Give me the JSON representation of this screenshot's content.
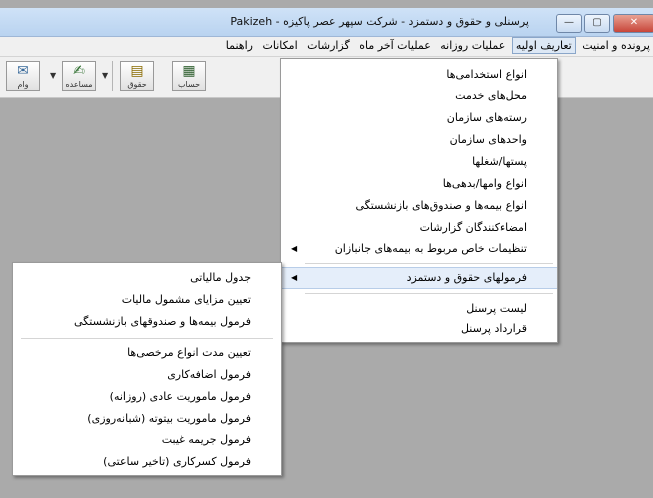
{
  "window": {
    "title": "پرسنلی و حقوق و دستمزد - شرکت سپهر عصر پاکیزه - Pakizeh",
    "buttons": {
      "close": "✕",
      "maximize": "▢",
      "minimize": "—"
    }
  },
  "menubar": {
    "items": [
      "پرونده و امنیت",
      "تعاریف اولیه",
      "عملیات روزانه",
      "عملیات آخر ماه",
      "گزارشات",
      "امکانات",
      "راهنما"
    ]
  },
  "toolbar": {
    "icons": [
      {
        "name": "calculator-icon",
        "label": "حساب"
      },
      {
        "name": "sheet-icon",
        "label": "حقوق"
      },
      {
        "name": "assist-icon",
        "label": "مساعده"
      },
      {
        "name": "loan-icon",
        "label": "وام"
      }
    ]
  },
  "main_menu": {
    "items": [
      "انواع استخدامی‌ها",
      "محل‌های خدمت",
      "رسته‌های سازمان",
      "واحدهای سازمان",
      "پستها/شغلها",
      "انواع وامها/بدهی‌ها",
      "انواع بیمه‌ها و صندوق‌های بازنشستگی",
      "امضاءکنندگان گزارشات",
      "تنظیمات خاص مربوط به بیمه‌های جانبازان",
      "فرمولهای حقوق و دستمزد",
      "لیست پرسنل",
      "قرارداد پرسنل"
    ]
  },
  "sub_menu": {
    "items": [
      "جدول مالیاتی",
      "تعیین مزایای مشمول مالیات",
      "فرمول بیمه‌ها و صندوقهای بازنشستگی",
      "تعیین مدت انواع مرخصی‌ها",
      "فرمول اضافه‌کاری",
      "فرمول ماموریت عادی (روزانه)",
      "فرمول ماموریت بیتوته (شبانه‌روزی)",
      "فرمول جریمه غیبت",
      "فرمول کسرکاری (تاخیر ساعتی)"
    ]
  },
  "submenu_arrow": "◀"
}
